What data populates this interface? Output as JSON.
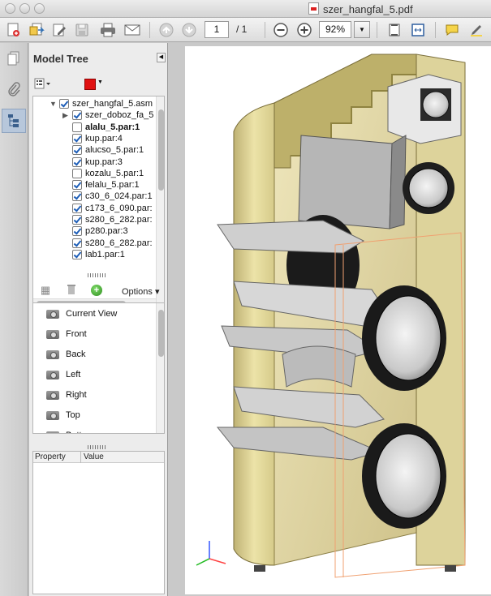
{
  "window": {
    "title": "szer_hangfal_5.pdf"
  },
  "toolbar": {
    "icons": [
      "create-pdf-icon",
      "export-icon",
      "edit-icon",
      "save-icon",
      "print-icon",
      "email-icon",
      "prev-page-icon",
      "next-page-icon",
      "zoom-out-icon",
      "zoom-in-icon",
      "fit-page-icon",
      "fit-width-icon",
      "comment-icon",
      "highlight-icon"
    ],
    "page_current": "1",
    "page_total": "/ 1",
    "zoom": "92%"
  },
  "model_tree": {
    "title": "Model Tree",
    "color_swatch": "#e01010",
    "items": [
      {
        "label": "szer_hangfal_5.asm",
        "level": 0,
        "checked": true,
        "expanded": true
      },
      {
        "label": "szer_doboz_fa_5",
        "level": 1,
        "checked": true,
        "expanded": false
      },
      {
        "label": "alalu_5.par:1",
        "level": 1,
        "checked": false,
        "selected": true
      },
      {
        "label": "kup.par:4",
        "level": 1,
        "checked": true
      },
      {
        "label": "alucso_5.par:1",
        "level": 1,
        "checked": true
      },
      {
        "label": "kup.par:3",
        "level": 1,
        "checked": true
      },
      {
        "label": "kozalu_5.par:1",
        "level": 1,
        "checked": false
      },
      {
        "label": "felalu_5.par:1",
        "level": 1,
        "checked": true
      },
      {
        "label": "c30_6_024.par:1",
        "level": 1,
        "checked": true
      },
      {
        "label": "c173_6_090.par:",
        "level": 1,
        "checked": true
      },
      {
        "label": "s280_6_282.par:",
        "level": 1,
        "checked": true
      },
      {
        "label": "p280.par:3",
        "level": 1,
        "checked": true
      },
      {
        "label": "s280_6_282.par:",
        "level": 1,
        "checked": true
      },
      {
        "label": "lab1.par:1",
        "level": 1,
        "checked": true
      }
    ]
  },
  "views": {
    "options_label": "Options",
    "items": [
      "Current View",
      "Front",
      "Back",
      "Left",
      "Right",
      "Top",
      "Bottom"
    ]
  },
  "properties": {
    "col_property": "Property",
    "col_value": "Value"
  }
}
